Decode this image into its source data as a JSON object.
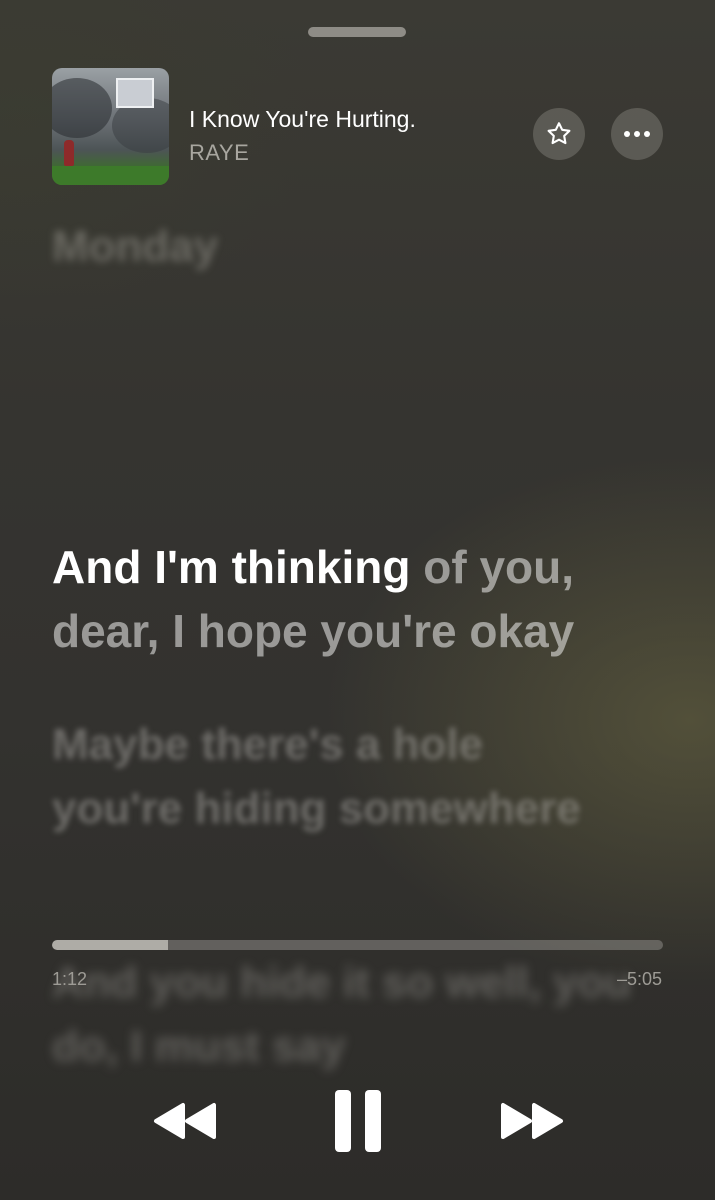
{
  "now_playing": {
    "title": "I Know You're Hurting.",
    "artist": "RAYE"
  },
  "actions": {
    "favorite_icon": "star-icon",
    "more_icon": "ellipsis-icon"
  },
  "lyrics": {
    "previous": "Monday",
    "current_sung": "And I'm thinking",
    "current_remaining": " of you, dear, I hope you're okay",
    "next": "Maybe there's a hole you're hiding somewhere",
    "following": "And you hide it so well, you do, I must say"
  },
  "playback": {
    "elapsed": "1:12",
    "remaining": "–5:05",
    "progress_fraction": 0.19
  },
  "controls": {
    "rewind_icon": "backward-icon",
    "pause_icon": "pause-icon",
    "forward_icon": "forward-icon"
  },
  "colors": {
    "accent": "#ffffff",
    "background": "#353430"
  }
}
